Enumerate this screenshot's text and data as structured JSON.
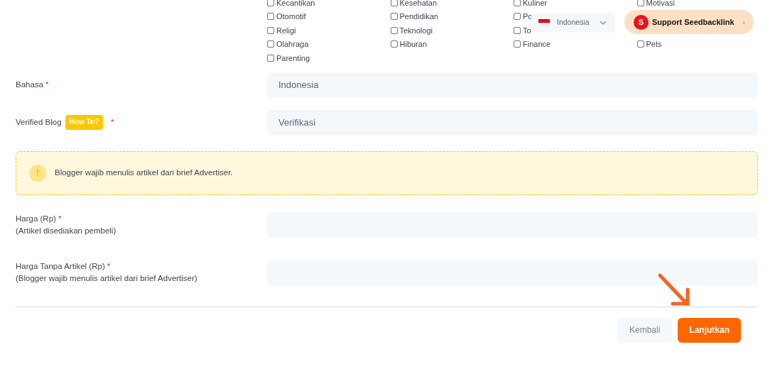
{
  "categories": {
    "rows": [
      {
        "items": [
          {
            "label": "Kecantikan",
            "checked": false
          },
          {
            "label": "Kesehatan",
            "checked": false
          },
          {
            "label": "Kuliner",
            "checked": false
          },
          {
            "label": "Motivasi",
            "checked": false
          }
        ]
      },
      {
        "items": [
          {
            "label": "Otomotif",
            "checked": false
          },
          {
            "label": "Pendidikan",
            "checked": false
          },
          {
            "label": "Po",
            "checked": false
          }
        ]
      },
      {
        "items": [
          {
            "label": "Religi",
            "checked": false
          },
          {
            "label": "Teknologi",
            "checked": false
          },
          {
            "label": "To",
            "checked": false
          }
        ]
      },
      {
        "items": [
          {
            "label": "Olahraga",
            "checked": false
          },
          {
            "label": "Hiburan",
            "checked": false
          },
          {
            "label": "Finance",
            "checked": false
          },
          {
            "label": "Pets",
            "checked": false
          }
        ]
      },
      {
        "items": [
          {
            "label": "Parenting",
            "checked": false
          }
        ]
      }
    ]
  },
  "language_menu": {
    "label": "Indonesia"
  },
  "support_button": {
    "badge": "S",
    "label": "Support Seedbacklink",
    "chevron": "›"
  },
  "form_rows": [
    {
      "kind": "field",
      "label": "Bahasa",
      "required_mark": "*",
      "value": "Indonesia"
    },
    {
      "kind": "field",
      "label": "Verified Blog",
      "help_badge": "How To?",
      "required_mark": "*",
      "value": "Verifikasi"
    },
    {
      "kind": "alert",
      "icon": "!",
      "text": "Blogger wajib menulis artikel dari brief Advertiser."
    },
    {
      "kind": "field",
      "label": "Harga (Rp)",
      "required_mark": "*",
      "sublabel": "(Artikel disediakan pembeli)",
      "value": ""
    },
    {
      "kind": "field",
      "label": "Harga Tanpa Artikel (Rp)",
      "required_mark": "*",
      "sublabel": "(Blogger wajib menulis artikel dari brief Advertiser)",
      "value": ""
    }
  ],
  "buttons": [
    {
      "kind": "secondary",
      "label": "Kembali"
    },
    {
      "kind": "primary",
      "label": "Lanjutkan"
    }
  ]
}
